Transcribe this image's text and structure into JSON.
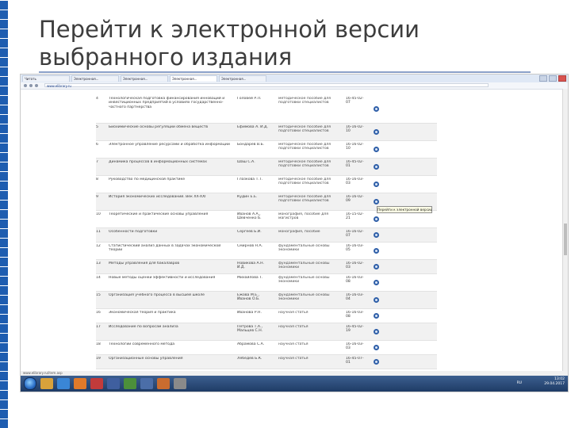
{
  "slide": {
    "title_line1": "Перейти к электронной версии",
    "title_line2": "выбранного издания"
  },
  "browser": {
    "tabs": [
      "Читать",
      "Электронная...",
      "Электронная...",
      "Электронная...",
      "Электронная..."
    ],
    "address": "www.elibrary.ru",
    "tooltip": "Перейти к электронной версии"
  },
  "rows": [
    {
      "num": "4",
      "title": "Технологическая подготовка финансирования инноваций и инвестиционных предприятий в условиях государственно-частного партнерства",
      "author": "Головей Р.Л.",
      "kind": "методическое пособие для подготовки специалистов",
      "code": "16-45-02-07"
    },
    {
      "num": "5",
      "title": "Биохимические основы регуляции обмена веществ",
      "author": "Ефимова А. И.Д.",
      "kind": "методическое пособие для подготовки специалистов",
      "code": "16-16-02-10"
    },
    {
      "num": "6",
      "title": "Электронное управление ресурсами и обработка информации",
      "author": "Бондарев В.Б.",
      "kind": "методическое пособие для подготовки специалистов",
      "code": "16-16-02-10"
    },
    {
      "num": "7",
      "title": "Динамика процессов в информационных системах",
      "author": "Шаш С.А.",
      "kind": "методическое пособие для подготовки специалистов",
      "code": "16-45-02-01"
    },
    {
      "num": "8",
      "title": "Руководство по медицинской практике",
      "author": "Глазкова Т.Т.",
      "kind": "методическое пособие для подготовки специалистов",
      "code": "16-16-03-03"
    },
    {
      "num": "9",
      "title": "История экономических исследований. Век XX-XXI",
      "author": "Кудин Е.Е.",
      "kind": "методическое пособие для подготовки специалистов",
      "code": "16-16-02-09"
    },
    {
      "num": "10",
      "title": "Теоретические и практические основы управления",
      "author": "Иванов А.А., Шевченко Б.",
      "kind": "монография, пособие для магистров",
      "code": "16-15-02-21"
    },
    {
      "num": "11",
      "title": "Особенности подготовки",
      "author": "Сергеев Б.И.",
      "kind": "монография, пособие",
      "code": "16-16-02-07"
    },
    {
      "num": "12",
      "title": "Статистический анализ данных в задачах экономической теории",
      "author": "Смирнов Н.А.",
      "kind": "фундаментальные основы экономики",
      "code": "16-16-03-05"
    },
    {
      "num": "13",
      "title": "Методы управления для бакалавров",
      "author": "Новикова А.Н. И.Д.",
      "kind": "фундаментальные основы экономики",
      "code": "16-16-02-03"
    },
    {
      "num": "14",
      "title": "Новые методы оценки эффективности и исследования",
      "author": "Михайлова Т.",
      "kind": "фундаментальные основы экономики",
      "code": "16-16-03-08"
    },
    {
      "num": "15",
      "title": "Организация учебного процесса в высшей школе",
      "author": "Ежова М.Е., Иванов О.Б.",
      "kind": "фундаментальные основы экономики",
      "code": "16-16-03-04"
    },
    {
      "num": "16",
      "title": "Экономическая теория и практика",
      "author": "Иванова Р.Н.",
      "kind": "научная статья",
      "code": "16-16-03-08"
    },
    {
      "num": "17",
      "title": "Исследование по вопросам анализа",
      "author": "Петрова Т.А., Мальцев С.Н.",
      "kind": "научная статья",
      "code": "16-45-02-19"
    },
    {
      "num": "18",
      "title": "Технологии современного метода",
      "author": "Абрамова С.А.",
      "kind": "научная статья",
      "code": "16-16-03-03"
    },
    {
      "num": "19",
      "title": "Организационные основы управления",
      "author": "Лебедев Б.К.",
      "kind": "научная статья",
      "code": "16-45-07-01"
    }
  ],
  "statusbar": "www.elibrary.ru/item.asp",
  "tray": {
    "lang": "RU",
    "time": "13:02",
    "date": "29.04.2017"
  },
  "colors": {
    "accent": "#1e5db0",
    "button": "#2f5fa8",
    "title": "#3d3d3d"
  }
}
